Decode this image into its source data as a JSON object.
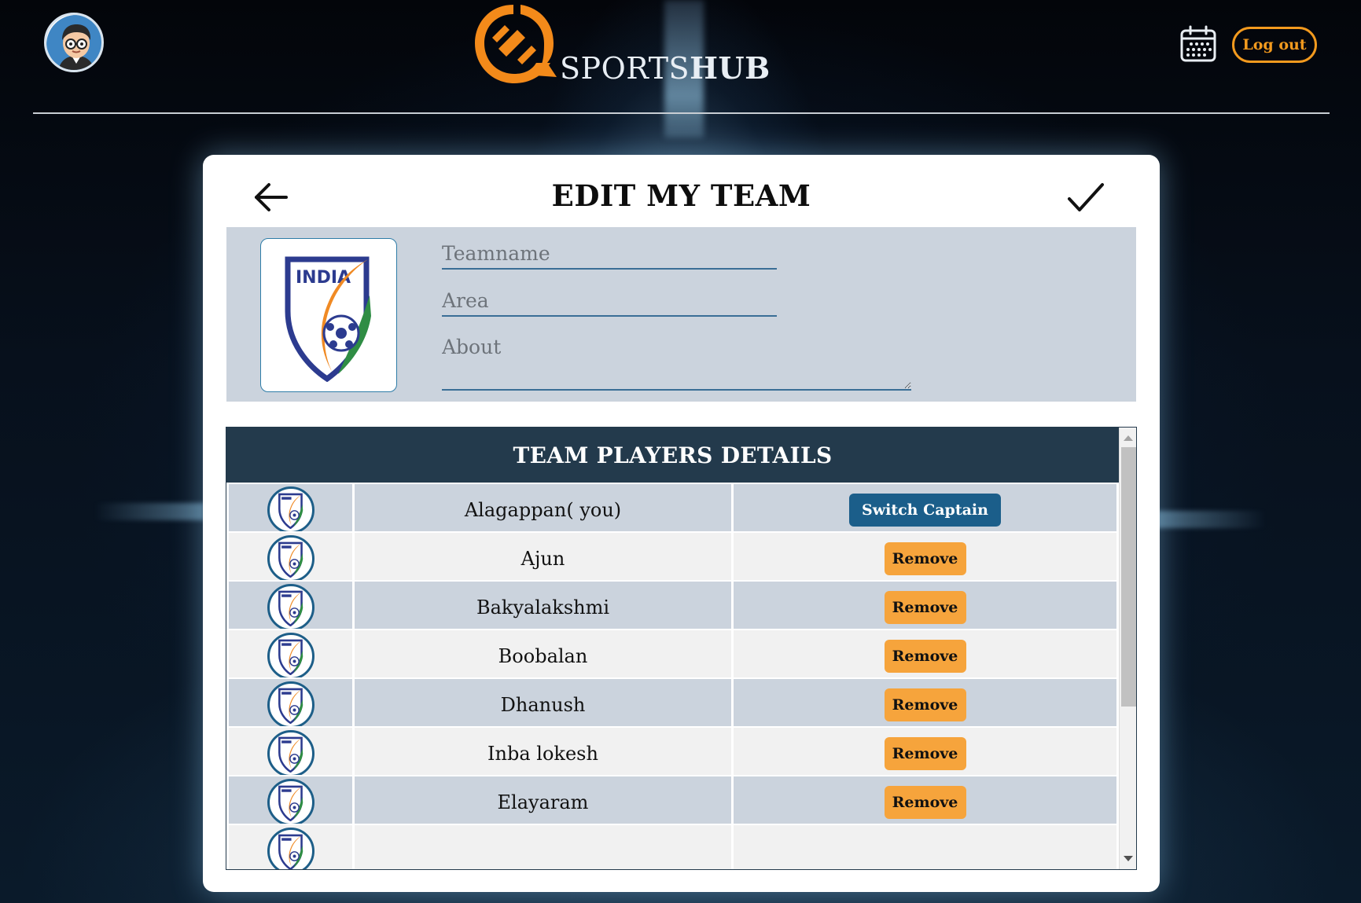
{
  "header": {
    "brand_light": "SPORTS",
    "brand_bold": "HUB",
    "logout_label": "Log out",
    "icons": {
      "avatar": "user-avatar",
      "calendar": "calendar-icon",
      "logo": "sportshub-logo"
    }
  },
  "card": {
    "title": "EDIT MY TEAM",
    "icons": {
      "back": "arrow-left-icon",
      "confirm": "checkmark-icon"
    }
  },
  "form": {
    "teamname_placeholder": "Teamname",
    "teamname_value": "",
    "area_placeholder": "Area",
    "area_value": "",
    "about_placeholder": "About",
    "about_value": "",
    "logo_text": "INDIA"
  },
  "players": {
    "heading": "TEAM PLAYERS DETAILS",
    "rows": [
      {
        "name": "Alagappan( you)",
        "action": "Switch Captain"
      },
      {
        "name": "Ajun",
        "action": "Remove"
      },
      {
        "name": "Bakyalakshmi",
        "action": "Remove"
      },
      {
        "name": "Boobalan",
        "action": "Remove"
      },
      {
        "name": "Dhanush",
        "action": "Remove"
      },
      {
        "name": "Inba lokesh",
        "action": "Remove"
      },
      {
        "name": "Elayaram",
        "action": "Remove"
      }
    ]
  },
  "colors": {
    "accent_orange": "#f39a1e",
    "captain_blue": "#1b5e8a",
    "table_head": "#233a4c",
    "panel": "#cbd3dd"
  }
}
